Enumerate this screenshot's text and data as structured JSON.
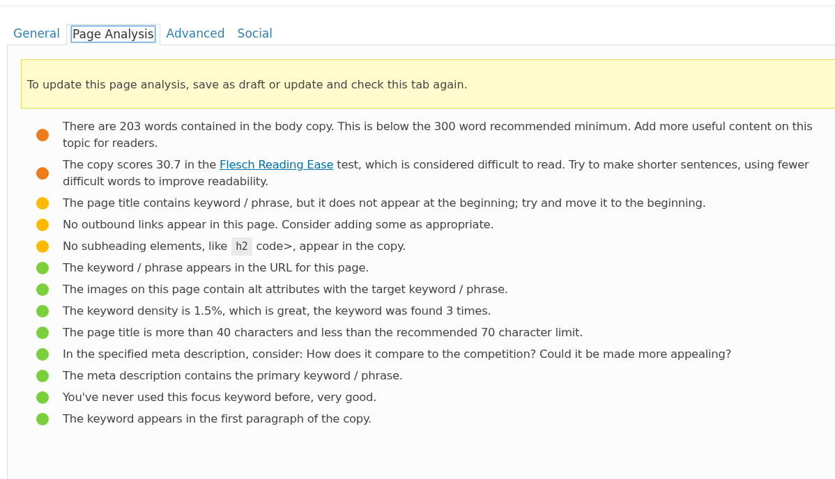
{
  "tabs": [
    {
      "label": "General",
      "selected": false
    },
    {
      "label": "Page Analysis",
      "selected": true
    },
    {
      "label": "Advanced",
      "selected": false
    },
    {
      "label": "Social",
      "selected": false
    }
  ],
  "notice": "To update this page analysis, save as draft or update and check this tab again.",
  "results": [
    {
      "color": "#ee7c1b",
      "parts": [
        {
          "kind": "text",
          "text": "There are 203 words contained in the body copy. This is below the 300 word recommended minimum. Add more useful content on this topic for readers."
        }
      ]
    },
    {
      "color": "#ee7c1b",
      "parts": [
        {
          "kind": "text",
          "text": "The copy scores 30.7 in the "
        },
        {
          "kind": "link",
          "text": "Flesch Reading Ease"
        },
        {
          "kind": "text",
          "text": " test, which is considered difficult to read. Try to make shorter sentences, using fewer difficult words to improve readability."
        }
      ]
    },
    {
      "color": "#ffb900",
      "parts": [
        {
          "kind": "text",
          "text": "The page title contains keyword / phrase, but it does not appear at the beginning; try and move it to the beginning."
        }
      ]
    },
    {
      "color": "#ffb900",
      "parts": [
        {
          "kind": "text",
          "text": "No outbound links appear in this page. Consider adding some as appropriate."
        }
      ]
    },
    {
      "color": "#ffb900",
      "parts": [
        {
          "kind": "text",
          "text": "No subheading elements, like "
        },
        {
          "kind": "code",
          "text": "h2"
        },
        {
          "kind": "text",
          "text": " code>, appear in the copy."
        }
      ]
    },
    {
      "color": "#7ad03a",
      "parts": [
        {
          "kind": "text",
          "text": "The keyword / phrase appears in the URL for this page."
        }
      ]
    },
    {
      "color": "#7ad03a",
      "parts": [
        {
          "kind": "text",
          "text": "The images on this page contain alt attributes with the target keyword / phrase."
        }
      ]
    },
    {
      "color": "#7ad03a",
      "parts": [
        {
          "kind": "text",
          "text": "The keyword density is 1.5%, which is great, the keyword was found 3 times."
        }
      ]
    },
    {
      "color": "#7ad03a",
      "parts": [
        {
          "kind": "text",
          "text": "The page title is more than 40 characters and less than the recommended 70 character limit."
        }
      ]
    },
    {
      "color": "#7ad03a",
      "parts": [
        {
          "kind": "text",
          "text": "In the specified meta description, consider: How does it compare to the competition? Could it be made more appealing?"
        }
      ]
    },
    {
      "color": "#7ad03a",
      "parts": [
        {
          "kind": "text",
          "text": "The meta description contains the primary keyword / phrase."
        }
      ]
    },
    {
      "color": "#7ad03a",
      "parts": [
        {
          "kind": "text",
          "text": "You've never used this focus keyword before, very good."
        }
      ]
    },
    {
      "color": "#7ad03a",
      "parts": [
        {
          "kind": "text",
          "text": "The keyword appears in the first paragraph of the copy."
        }
      ]
    }
  ]
}
